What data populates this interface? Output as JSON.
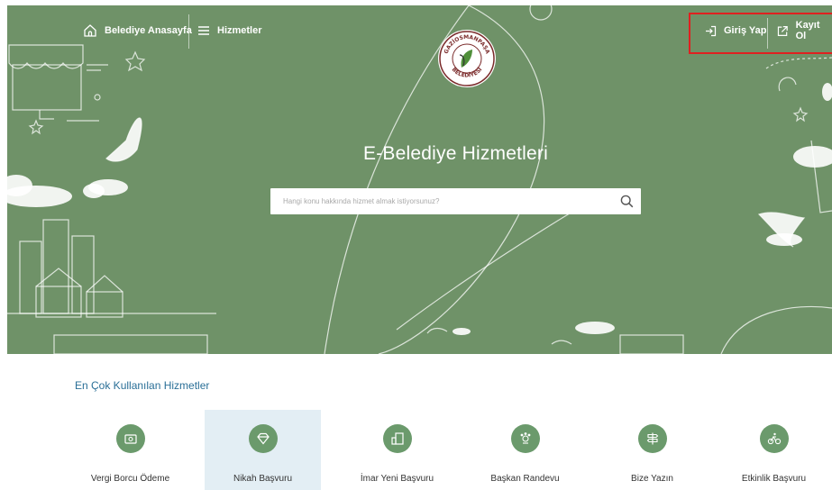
{
  "nav": {
    "home_label": "Belediye Anasayfa",
    "services_label": "Hizmetler",
    "login_label": "Giriş Yap",
    "register_label": "Kayıt Ol"
  },
  "logo": {
    "top_text": "GAZİOSMANPAŞA",
    "bottom_text": "BELEDİYESİ"
  },
  "hero": {
    "title": "E-Belediye Hizmetleri",
    "search_placeholder": "Hangi konu hakkında hizmet almak istiyorsunuz?"
  },
  "section": {
    "title": "En Çok Kullanılan Hizmetler"
  },
  "services": [
    {
      "label": "Vergi Borcu Ödeme",
      "icon": "bill-icon",
      "active": false
    },
    {
      "label": "Nikah Başvuru",
      "icon": "diamond-icon",
      "active": true
    },
    {
      "label": "İmar Yeni Başvuru",
      "icon": "building-icon",
      "active": false
    },
    {
      "label": "Başkan Randevu",
      "icon": "meeting-icon",
      "active": false
    },
    {
      "label": "Bize Yazın",
      "icon": "signpost-icon",
      "active": false
    },
    {
      "label": "Etkinlik Başvuru",
      "icon": "bicycle-icon",
      "active": false
    }
  ],
  "colors": {
    "hero_green": "#6f9268",
    "icon_green": "#6b9a6c",
    "section_title": "#2a6f97",
    "active_tile": "#e3eef4",
    "highlight_border": "#e02020"
  }
}
